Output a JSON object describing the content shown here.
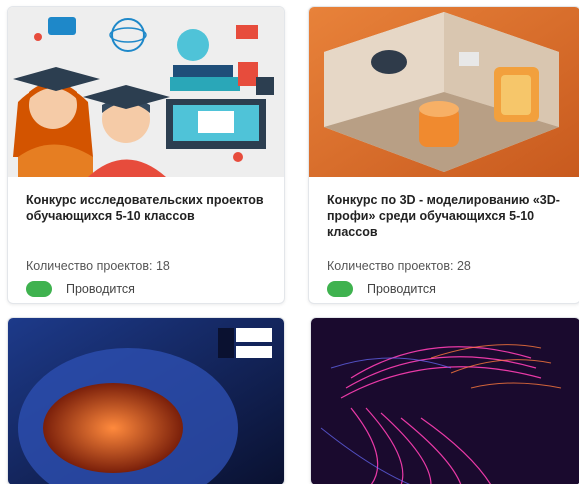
{
  "cards": [
    {
      "title": "Конкурс исследовательских проектов обучающихся 5-10 классов",
      "count_label": "Количество проектов: 18",
      "status": "Проводится",
      "image_icon": "education-students-illustration"
    },
    {
      "title": "Конкурс по 3D - моделированию «3D-профи» среди обучающихся 5-10 классов",
      "count_label": "Количество проектов: 28",
      "status": "Проводится",
      "image_icon": "3d-room-render"
    },
    {
      "image_icon": "astronaut-helmet-image"
    },
    {
      "image_icon": "vr-headset-neon-image"
    }
  ],
  "colors": {
    "status_active": "#3fb24f",
    "card_border": "#e3e6ea"
  }
}
